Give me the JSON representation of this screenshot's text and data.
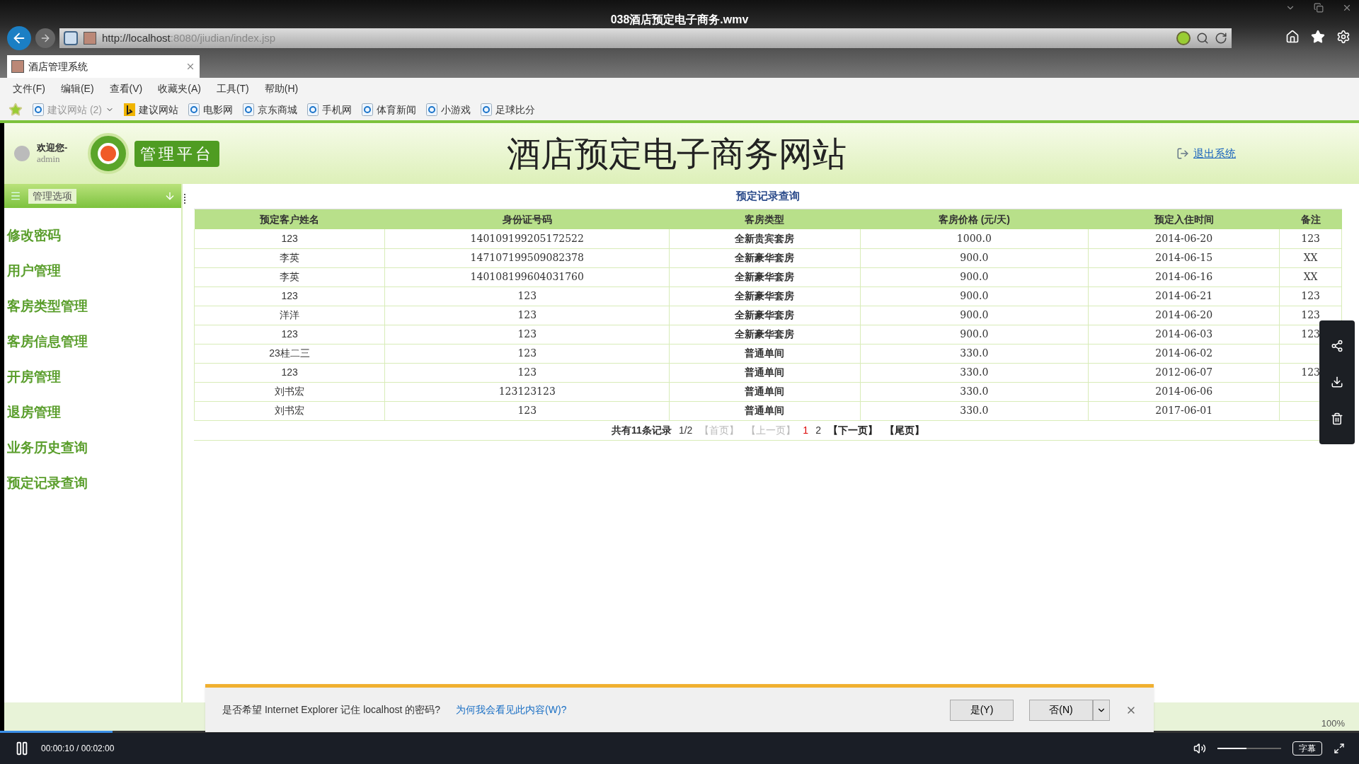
{
  "video": {
    "title": "038酒店预定电子商务.wmv",
    "time": "00:00:10 / 00:02:00",
    "progress": {
      "level": 0.083
    },
    "volume": {
      "level": 0.45
    },
    "subtitle_button": "字幕"
  },
  "browser": {
    "url_host": "http://localhost",
    "url_rest": ":8080/jiudian/index.jsp",
    "tab": {
      "title": "酒店管理系统"
    },
    "menu": [
      "文件(F)",
      "编辑(E)",
      "查看(V)",
      "收藏夹(A)",
      "工具(T)",
      "帮助(H)"
    ],
    "favorites": [
      {
        "label": "建议网站 (2)",
        "kind": "suggested"
      },
      {
        "label": "建议网站",
        "kind": "bing"
      },
      {
        "label": "电影网",
        "kind": "ie"
      },
      {
        "label": "京东商城",
        "kind": "ie"
      },
      {
        "label": "手机网",
        "kind": "ie"
      },
      {
        "label": "体育新闻",
        "kind": "ie"
      },
      {
        "label": "小游戏",
        "kind": "ie"
      },
      {
        "label": "足球比分",
        "kind": "ie"
      }
    ],
    "zoom": "100%"
  },
  "header": {
    "welcome": "欢迎您-",
    "user": "admin",
    "badge": "管理平台",
    "site_title": "酒店预定电子商务网站",
    "logout": "退出系统"
  },
  "sidebar": {
    "title": "管理选项",
    "items": [
      {
        "label": "修改密码",
        "selected": false
      },
      {
        "label": "用户管理",
        "selected": false
      },
      {
        "label": "客房类型管理",
        "selected": false
      },
      {
        "label": "客房信息管理",
        "selected": false
      },
      {
        "label": "开房管理",
        "selected": false
      },
      {
        "label": "退房管理",
        "selected": false
      },
      {
        "label": "业务历史查询",
        "selected": false
      },
      {
        "label": "预定记录查询",
        "selected": false
      }
    ]
  },
  "table": {
    "title": "预定记录查询",
    "columns": [
      "预定客户姓名",
      "身份证号码",
      "客房类型",
      "客房价格 (元/天)",
      "预定入住时间",
      "备注"
    ],
    "rows": [
      [
        "123",
        "140109199205172522",
        "全新贵宾套房",
        "1000.0",
        "2014-06-20",
        "123"
      ],
      [
        "李英",
        "147107199509082378",
        "全新豪华套房",
        "900.0",
        "2014-06-15",
        "XX"
      ],
      [
        "李英",
        "140108199604031760",
        "全新豪华套房",
        "900.0",
        "2014-06-16",
        "XX"
      ],
      [
        "123",
        "123",
        "全新豪华套房",
        "900.0",
        "2014-06-21",
        "123"
      ],
      [
        "洋洋",
        "123",
        "全新豪华套房",
        "900.0",
        "2014-06-20",
        "123"
      ],
      [
        "123",
        "123",
        "全新豪华套房",
        "900.0",
        "2014-06-03",
        "123"
      ],
      [
        "23桂二三",
        "123",
        "普通单间",
        "330.0",
        "2014-06-02",
        ""
      ],
      [
        "123",
        "123",
        "普通单间",
        "330.0",
        "2012-06-07",
        "123"
      ],
      [
        "刘书宏",
        "123123123",
        "普通单间",
        "330.0",
        "2014-06-06",
        ""
      ],
      [
        "刘书宏",
        "123",
        "普通单间",
        "330.0",
        "2017-06-01",
        ""
      ]
    ],
    "pagination": {
      "summary": "共有11条记录",
      "page": "1/2",
      "links": [
        {
          "label": "【首页】",
          "kind": "nav",
          "disabled": true
        },
        {
          "label": "【上一页】",
          "kind": "nav",
          "disabled": true
        },
        {
          "label": "1",
          "kind": "page",
          "selected": true
        },
        {
          "label": "2",
          "kind": "page",
          "selected": false
        },
        {
          "label": "【下一页】",
          "kind": "nav",
          "disabled": false
        },
        {
          "label": "【尾页】",
          "kind": "nav",
          "disabled": false
        }
      ]
    }
  },
  "notification": {
    "message": "是否希望 Internet Explorer 记住 localhost 的密码?",
    "link": "为何我会看见此内容(W)?",
    "buttons": [
      "是(Y)",
      "否(N)"
    ]
  }
}
